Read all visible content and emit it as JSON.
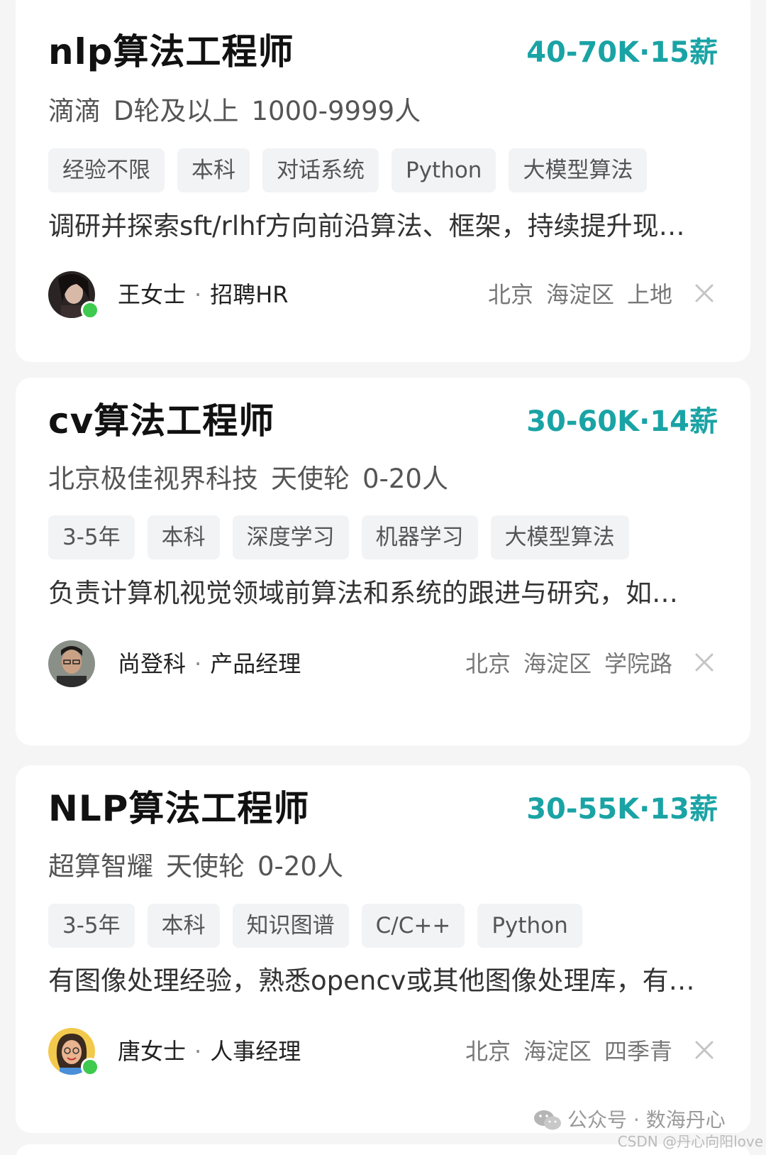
{
  "jobs": [
    {
      "title": "nlp算法工程师",
      "salary": "40-70K·15薪",
      "company": [
        "滴滴",
        "D轮及以上",
        "1000-9999人"
      ],
      "tags": [
        "经验不限",
        "本科",
        "对话系统",
        "Python",
        "大模型算法"
      ],
      "description": "调研并探索sft/rlhf方向前沿算法、框架，持续提升现…",
      "recruiter": {
        "name": "王女士",
        "role": "招聘HR",
        "online": true
      },
      "location": [
        "北京",
        "海淀区",
        "上地"
      ]
    },
    {
      "title": "cv算法工程师",
      "salary": "30-60K·14薪",
      "company": [
        "北京极佳视界科技",
        "天使轮",
        "0-20人"
      ],
      "tags": [
        "3-5年",
        "本科",
        "深度学习",
        "机器学习",
        "大模型算法"
      ],
      "description": "负责计算机视觉领域前算法和系统的跟进与研究，如…",
      "recruiter": {
        "name": "尚登科",
        "role": "产品经理",
        "online": false
      },
      "location": [
        "北京",
        "海淀区",
        "学院路"
      ]
    },
    {
      "title": "NLP算法工程师",
      "salary": "30-55K·13薪",
      "company": [
        "超算智耀",
        "天使轮",
        "0-20人"
      ],
      "tags": [
        "3-5年",
        "本科",
        "知识图谱",
        "C/C++",
        "Python"
      ],
      "description": "有图像处理经验，熟悉opencv或其他图像处理库，有…",
      "recruiter": {
        "name": "唐女士",
        "role": "人事经理",
        "online": true
      },
      "location": [
        "北京",
        "海淀区",
        "四季青"
      ]
    }
  ],
  "watermark": {
    "text": "公众号 · 数海丹心",
    "icon": "wechat-icon"
  },
  "csdn_watermark": "CSDN @丹心向阳love",
  "colors": {
    "salary": "#1aa3a5",
    "online": "#3ec94f",
    "tag_bg": "#f2f3f5"
  }
}
